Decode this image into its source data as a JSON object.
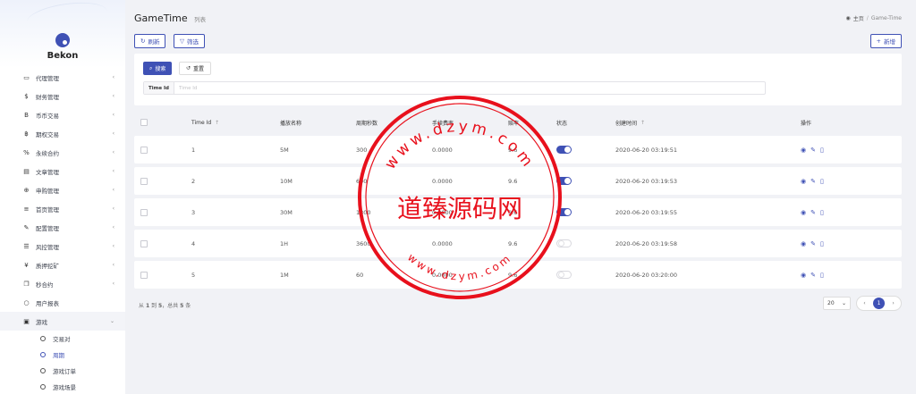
{
  "brand": {
    "name": "Bekon"
  },
  "sidebar": {
    "items": [
      {
        "label": "代理管理",
        "icon": "agent-icon",
        "glyph": "▭",
        "arrow": "‹"
      },
      {
        "label": "财务管理",
        "icon": "dollar-icon",
        "glyph": "$",
        "arrow": "‹"
      },
      {
        "label": "币币交易",
        "icon": "bitcoin-icon",
        "glyph": "B",
        "arrow": "‹"
      },
      {
        "label": "期权交易",
        "icon": "bitcoin-small-icon",
        "glyph": "฿",
        "arrow": "‹"
      },
      {
        "label": "永续合约",
        "icon": "link-icon",
        "glyph": "%",
        "arrow": "‹"
      },
      {
        "label": "文章管理",
        "icon": "article-icon",
        "glyph": "▤",
        "arrow": "‹"
      },
      {
        "label": "申购管理",
        "icon": "crosshair-icon",
        "glyph": "⊕",
        "arrow": "‹"
      },
      {
        "label": "首页管理",
        "icon": "list-icon",
        "glyph": "≡",
        "arrow": "‹"
      },
      {
        "label": "配置管理",
        "icon": "wrench-icon",
        "glyph": "✎",
        "arrow": "‹"
      },
      {
        "label": "风控管理",
        "icon": "list-bullet-icon",
        "glyph": "☰",
        "arrow": "‹"
      },
      {
        "label": "质押挖矿",
        "icon": "yen-icon",
        "glyph": "¥",
        "arrow": "‹"
      },
      {
        "label": "秒合约",
        "icon": "copy-icon",
        "glyph": "❐",
        "arrow": "‹"
      },
      {
        "label": "用户报表",
        "icon": "circle-icon",
        "glyph": "○",
        "arrow": ""
      },
      {
        "label": "游戏",
        "icon": "game-icon",
        "glyph": "▣",
        "arrow": "⌄"
      }
    ],
    "game_submenu": [
      {
        "label": "交易对",
        "active": false
      },
      {
        "label": "周期",
        "active": true
      },
      {
        "label": "游戏订单",
        "active": false
      },
      {
        "label": "游戏场景",
        "active": false
      }
    ]
  },
  "header": {
    "title": "GameTime",
    "subtitle": "列表",
    "breadcrumb_home": "主页",
    "breadcrumb_sep": "/",
    "breadcrumb_current": "Game-Time"
  },
  "toolbar": {
    "refresh_label": "刷新",
    "filter_label": "筛选",
    "add_label": "新增"
  },
  "search": {
    "search_label": "搜索",
    "reset_label": "重置",
    "field_label": "Time Id",
    "placeholder": "Time Id",
    "value": ""
  },
  "table": {
    "columns": {
      "id": "Time Id",
      "name": "播放名称",
      "seconds": "周期秒数",
      "fee": "手续费率",
      "odds": "赔率",
      "status": "状态",
      "created": "创建时间",
      "actions": "操作"
    },
    "rows": [
      {
        "id": "1",
        "name": "5M",
        "seconds": "300",
        "fee": "0.0000",
        "odds": "9.6",
        "status": true,
        "created": "2020-06-20 03:19:51"
      },
      {
        "id": "2",
        "name": "10M",
        "seconds": "600",
        "fee": "0.0000",
        "odds": "9.6",
        "status": true,
        "created": "2020-06-20 03:19:53"
      },
      {
        "id": "3",
        "name": "30M",
        "seconds": "1800",
        "fee": "0.0000",
        "odds": "9.6",
        "status": true,
        "created": "2020-06-20 03:19:55"
      },
      {
        "id": "4",
        "name": "1H",
        "seconds": "3600",
        "fee": "0.0000",
        "odds": "9.6",
        "status": false,
        "created": "2020-06-20 03:19:58"
      },
      {
        "id": "5",
        "name": "1M",
        "seconds": "60",
        "fee": "0.0000",
        "odds": "9.6",
        "status": false,
        "created": "2020-06-20 03:20:00"
      }
    ]
  },
  "footer": {
    "info_prefix": "从",
    "from": "1",
    "to_word": "到",
    "to": "5",
    "total_word": "，总共",
    "total": "5",
    "unit": "条",
    "page_size": "20",
    "current_page": "1"
  },
  "watermark": {
    "title": "道臻源码网",
    "top_text": "www.dzym.com",
    "bottom_text": "www.dzym.com",
    "color": "#e8101c"
  },
  "colors": {
    "accent": "#3f51b5",
    "background": "#f1f2f6"
  }
}
